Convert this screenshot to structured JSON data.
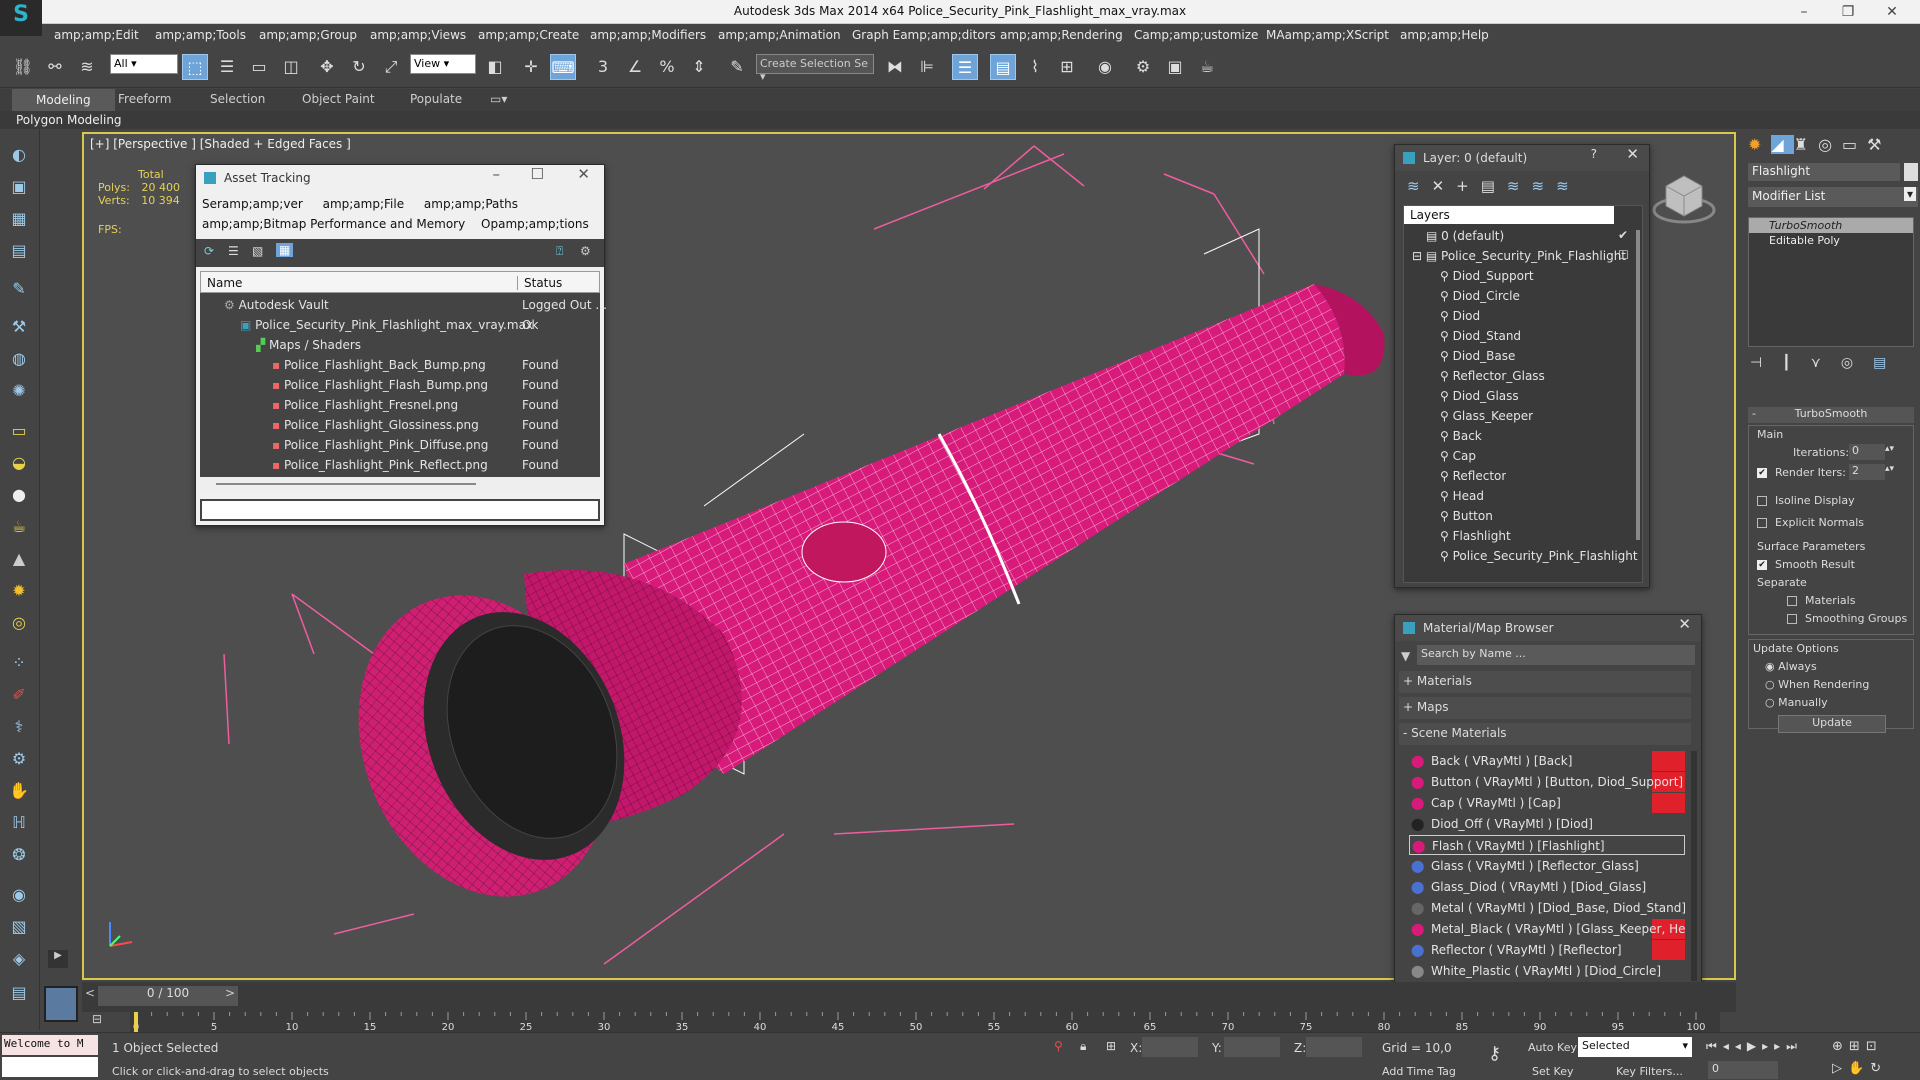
{
  "window": {
    "title": "Autodesk 3ds Max  2014 x64      Police_Security_Pink_Flashlight_max_vray.max",
    "logo": "S"
  },
  "menu": [
    "amp;amp;Edit",
    "amp;amp;Tools",
    "amp;amp;Group",
    "amp;amp;Views",
    "amp;amp;Create",
    "amp;amp;Modifiers",
    "amp;amp;Animation",
    "Graph Eamp;amp;ditors",
    "amp;amp;Rendering",
    "Camp;amp;ustomize",
    "MAamp;amp;XScript",
    "amp;amp;Help"
  ],
  "toolbar": {
    "selection_filter": "All",
    "ref_coord": "View",
    "named_selection": "Create Selection Se",
    "snap_labels": [
      "3",
      "%"
    ]
  },
  "ribbon": {
    "tabs": [
      "Modeling",
      "Freeform",
      "Selection",
      "Object Paint",
      "Populate"
    ],
    "sub": "Polygon Modeling"
  },
  "viewport": {
    "label": "[+] [Perspective ] [Shaded + Edged Faces ]",
    "stats": {
      "total": "Total",
      "polys_label": "Polys:",
      "polys": "20 400",
      "verts_label": "Verts:",
      "verts": "10 394",
      "fps_label": "FPS:"
    }
  },
  "asset_tracking": {
    "title": "Asset Tracking",
    "menu1": [
      "Seramp;amp;ver",
      "amp;amp;File",
      "amp;amp;Paths"
    ],
    "menu2": [
      "amp;amp;Bitmap Performance and Memory",
      "Opamp;amp;tions"
    ],
    "col_name": "Name",
    "col_status": "Status",
    "rows": [
      {
        "name": "Autodesk Vault",
        "status": "Logged Out ..."
      },
      {
        "name": "Police_Security_Pink_Flashlight_max_vray.max",
        "status": "Ok"
      },
      {
        "name": "Maps / Shaders",
        "status": ""
      },
      {
        "name": "Police_Flashlight_Back_Bump.png",
        "status": "Found"
      },
      {
        "name": "Police_Flashlight_Flash_Bump.png",
        "status": "Found"
      },
      {
        "name": "Police_Flashlight_Fresnel.png",
        "status": "Found"
      },
      {
        "name": "Police_Flashlight_Glossiness.png",
        "status": "Found"
      },
      {
        "name": "Police_Flashlight_Pink_Diffuse.png",
        "status": "Found"
      },
      {
        "name": "Police_Flashlight_Pink_Reflect.png",
        "status": "Found"
      }
    ]
  },
  "layers": {
    "title": "Layer: 0 (default)",
    "help": "?",
    "header": "Layers",
    "items": [
      "0 (default)",
      "Police_Security_Pink_Flashlight",
      "Diod_Support",
      "Diod_Circle",
      "Diod",
      "Diod_Stand",
      "Diod_Base",
      "Reflector_Glass",
      "Diod_Glass",
      "Glass_Keeper",
      "Back",
      "Cap",
      "Reflector",
      "Head",
      "Button",
      "Flashlight",
      "Police_Security_Pink_Flashlight"
    ]
  },
  "material_browser": {
    "title": "Material/Map Browser",
    "search_placeholder": "Search by Name ...",
    "groups": [
      "+ Materials",
      "+ Maps",
      "- Scene Materials"
    ],
    "materials": [
      "Back  ( VRayMtl )  [Back]",
      "Button  ( VRayMtl )  [Button, Diod_Support]",
      "Cap  ( VRayMtl )  [Cap]",
      "Diod_Off  ( VRayMtl )  [Diod]",
      "Flash  ( VRayMtl )  [Flashlight]",
      "Glass  ( VRayMtl )  [Reflector_Glass]",
      "Glass_Diod  ( VRayMtl )  [Diod_Glass]",
      "Metal  ( VRayMtl )  [Diod_Base, Diod_Stand]",
      "Metal_Black  ( VRayMtl )  [Glass_Keeper, Head]",
      "Reflector  ( VRayMtl )  [Reflector]",
      "White_Plastic  ( VRayMtl )  [Diod_Circle]"
    ]
  },
  "command_panel": {
    "object_name": "Flashlight",
    "modifier_list": "Modifier List",
    "stack": [
      "TurboSmooth",
      "Editable Poly"
    ],
    "rollout": "TurboSmooth",
    "main": "Main",
    "iterations_label": "Iterations:",
    "iterations": "0",
    "render_iters_label": "Render Iters:",
    "render_iters": "2",
    "isoline": "Isoline Display",
    "explicit": "Explicit Normals",
    "surface": "Surface Parameters",
    "smooth": "Smooth Result",
    "separate": "Separate",
    "materials": "Materials",
    "smoothing": "Smoothing Groups",
    "update_options": "Update Options",
    "always": "Always",
    "when_rendering": "When Rendering",
    "manually": "Manually",
    "update": "Update"
  },
  "timeline": {
    "frame": "0 / 100",
    "ticks": [
      "0",
      "5",
      "10",
      "15",
      "20",
      "25",
      "30",
      "35",
      "40",
      "45",
      "50",
      "55",
      "60",
      "65",
      "70",
      "75",
      "80",
      "85",
      "90",
      "95",
      "100"
    ]
  },
  "status": {
    "listener": "Welcome to M",
    "selected": "1 Object Selected",
    "prompt": "Click or click-and-drag to select objects",
    "x_label": "X:",
    "y_label": "Y:",
    "z_label": "Z:",
    "grid": "Grid = 10,0",
    "autokey": "Auto Key",
    "setkey": "Set Key",
    "key_mode": "Selected",
    "key_filters": "Key Filters...",
    "add_time_tag": "Add Time Tag",
    "frame_value": "0"
  },
  "colors": {
    "accent": "#6ea4d8",
    "viewport_border": "#d8c94a",
    "flashlight": "#d81b7a",
    "wire": "#ffffff",
    "stats": "#e2d15c"
  }
}
